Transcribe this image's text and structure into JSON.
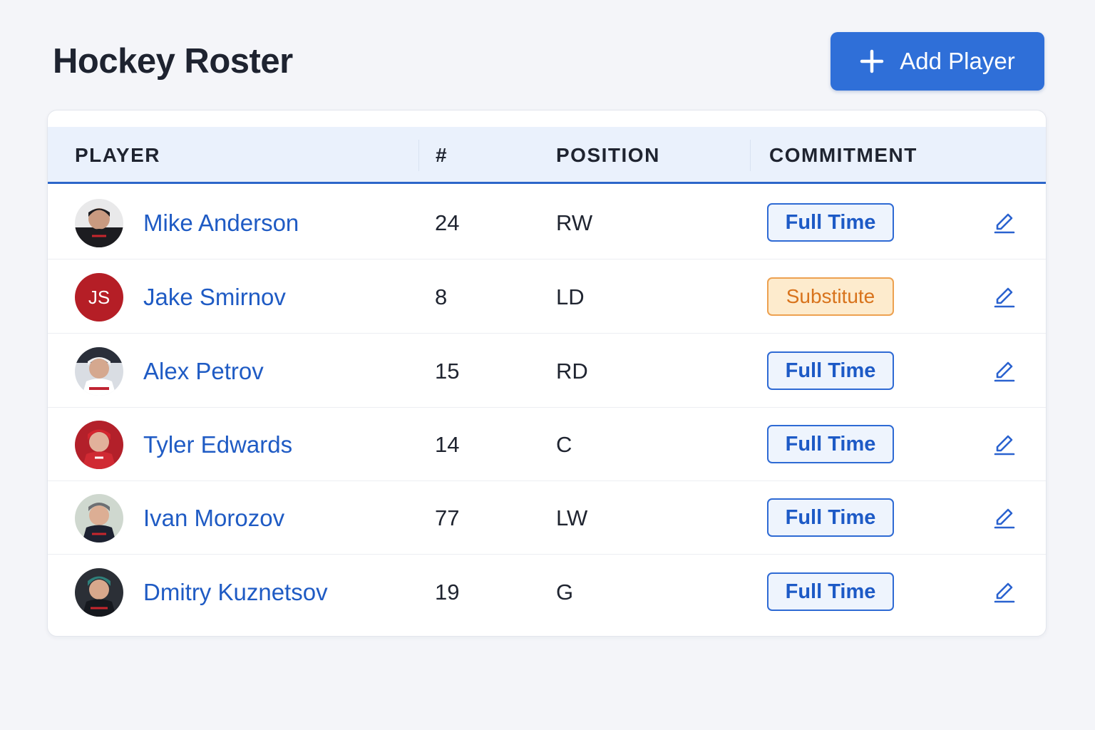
{
  "page": {
    "title": "Hockey Roster",
    "add_button_label": "Add Player",
    "accent_color": "#2f6fd8"
  },
  "table": {
    "columns": [
      "PLAYER",
      "#",
      "POSITION",
      "COMMITMENT"
    ],
    "rows": [
      {
        "name": "Mike Anderson",
        "number": "24",
        "position": "RW",
        "commitment": "Full Time",
        "avatar": "photo"
      },
      {
        "name": "Jake Smirnov",
        "number": "8",
        "position": "LD",
        "commitment": "Substitute",
        "avatar": "JS"
      },
      {
        "name": "Alex Petrov",
        "number": "15",
        "position": "RD",
        "commitment": "Full Time",
        "avatar": "photo"
      },
      {
        "name": "Tyler Edwards",
        "number": "14",
        "position": "C",
        "commitment": "Full Time",
        "avatar": "photo"
      },
      {
        "name": "Ivan Morozov",
        "number": "77",
        "position": "LW",
        "commitment": "Full Time",
        "avatar": "photo"
      },
      {
        "name": "Dmitry Kuznetsov",
        "number": "19",
        "position": "G",
        "commitment": "Full Time",
        "avatar": "photo"
      }
    ]
  },
  "icons": {
    "add": "plus-icon",
    "edit": "pencil-icon"
  },
  "status_colors": {
    "full_time": "#1d5ac6",
    "substitute": "#d8731c"
  }
}
